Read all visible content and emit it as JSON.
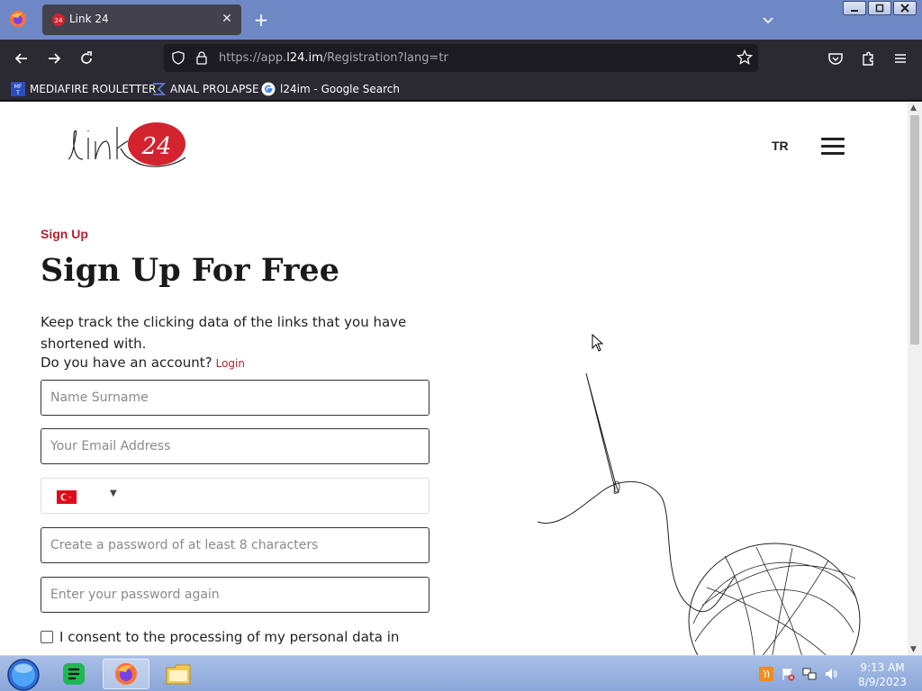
{
  "browser": {
    "tab_title": "Link 24",
    "url_prefix": "https://app.",
    "url_domain": "l24.im",
    "url_path": "/Registration?lang=tr",
    "bookmarks": [
      {
        "label": "MEDIAFIRE ROULETTER",
        "icon": "mediafire-icon"
      },
      {
        "label": "ANAL PROLAPSE",
        "icon": "bookmark-sigma-icon"
      },
      {
        "label": "l24im - Google Search",
        "icon": "google-icon"
      }
    ]
  },
  "header": {
    "logo": "link24",
    "language": "TR"
  },
  "form": {
    "kicker": "Sign Up",
    "title": "Sign Up For Free",
    "description": "Keep track the clicking data of the links that you have shortened with.",
    "account_question": "Do you have an account?",
    "login_link": "Login",
    "name_placeholder": "Name Surname",
    "email_placeholder": "Your Email Address",
    "phone_country": "TR",
    "password_placeholder": "Create a password of at least 8 characters",
    "password_confirm_placeholder": "Enter your password again",
    "consent_text": "I consent to the processing of my personal data in"
  },
  "taskbar": {
    "time": "9:13 AM",
    "date": "8/9/2023",
    "apps": [
      "start-orb",
      "notes-app",
      "firefox",
      "file-explorer"
    ]
  },
  "colors": {
    "accent": "#b0232e",
    "tabbar": "#6e88c6",
    "chrome": "#2b2a33"
  }
}
